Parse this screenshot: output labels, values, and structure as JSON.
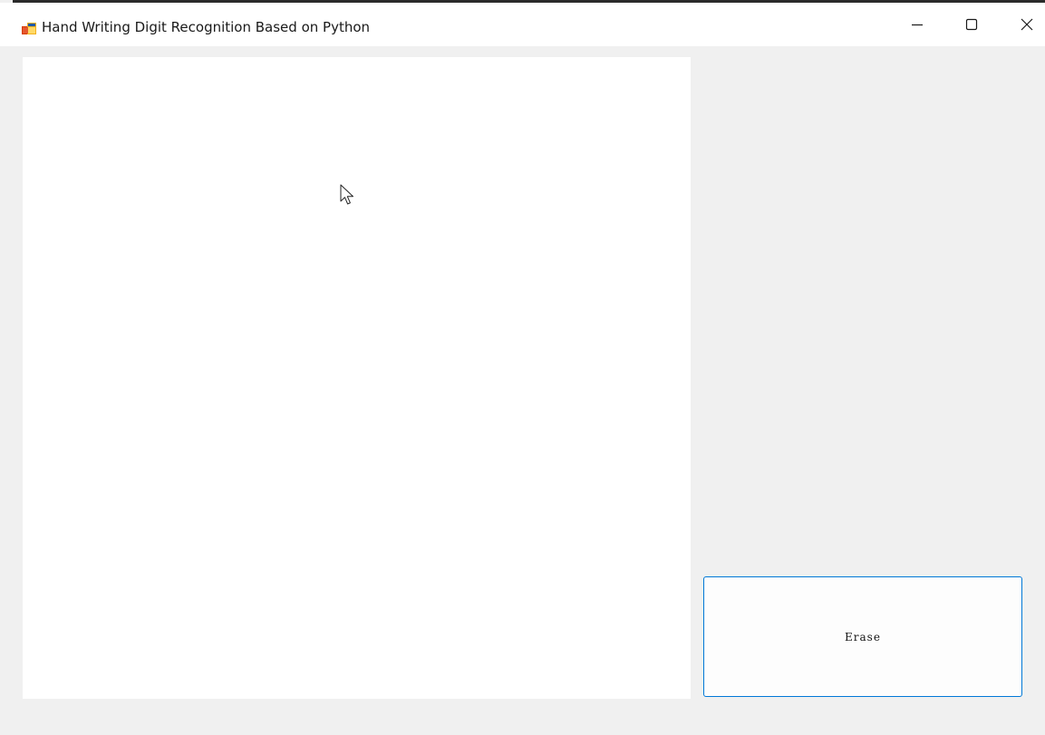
{
  "window": {
    "title": "Hand Writing Digit Recognition Based on Python",
    "icon": "app-window-icon",
    "controls": {
      "minimize_icon": "minimize-icon",
      "maximize_icon": "maximize-icon",
      "close_icon": "close-icon"
    }
  },
  "canvas": {
    "background": "#ffffff",
    "cursor_icon": "mouse-pointer-icon"
  },
  "erase_button": {
    "label": "Erase",
    "border_color": "#0078d7"
  },
  "colors": {
    "window_background": "#f0f0f0",
    "titlebar_background": "#ffffff",
    "accent": "#0078d7"
  }
}
